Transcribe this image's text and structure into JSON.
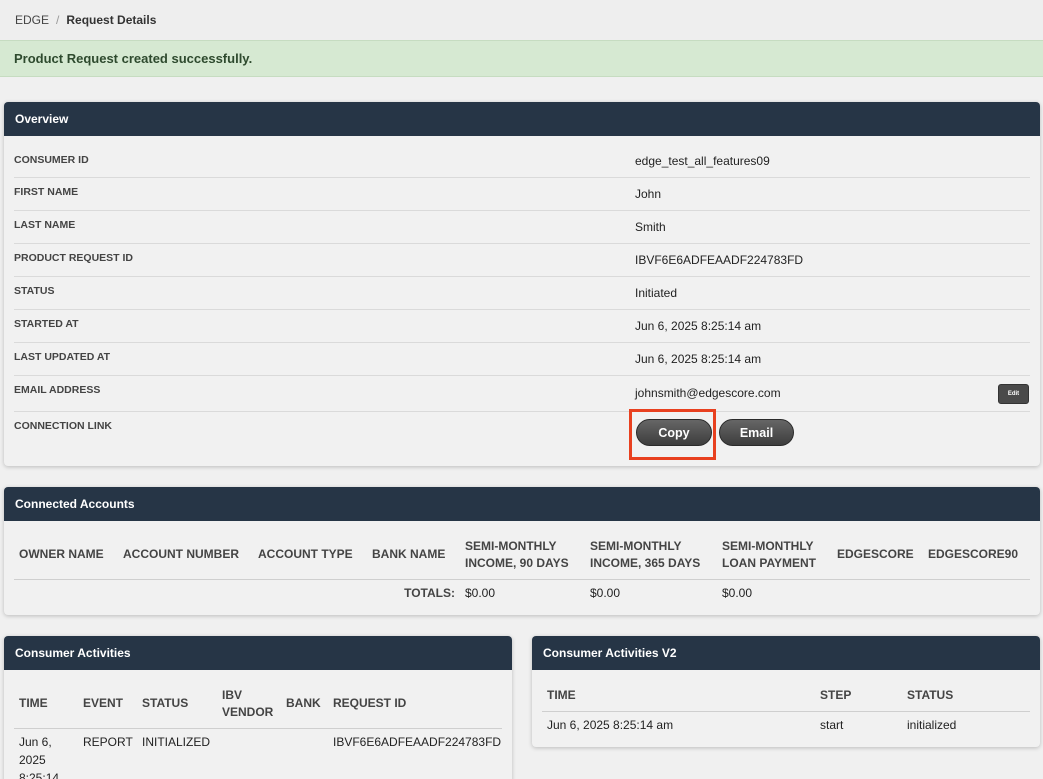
{
  "breadcrumb": {
    "root": "EDGE",
    "separator": "/",
    "current": "Request Details"
  },
  "alert": {
    "message": "Product Request created successfully."
  },
  "overview": {
    "title": "Overview",
    "rows": [
      {
        "label": "CONSUMER ID",
        "value": "edge_test_all_features09"
      },
      {
        "label": "FIRST NAME",
        "value": "John"
      },
      {
        "label": "LAST NAME",
        "value": "Smith"
      },
      {
        "label": "PRODUCT REQUEST ID",
        "value": "IBVF6E6ADFEAADF224783FD"
      },
      {
        "label": "STATUS",
        "value": "Initiated"
      },
      {
        "label": "STARTED AT",
        "value": "Jun 6, 2025 8:25:14 am"
      },
      {
        "label": "LAST UPDATED AT",
        "value": "Jun 6, 2025 8:25:14 am"
      },
      {
        "label": "EMAIL ADDRESS",
        "value": "johnsmith@edgescore.com"
      },
      {
        "label": "CONNECTION LINK",
        "value": ""
      }
    ],
    "edit_label": "Edit",
    "copy_label": "Copy",
    "email_label": "Email"
  },
  "connected_accounts": {
    "title": "Connected Accounts",
    "columns": [
      "OWNER NAME",
      "ACCOUNT NUMBER",
      "ACCOUNT TYPE",
      "BANK NAME",
      "SEMI-MONTHLY INCOME, 90 DAYS",
      "SEMI-MONTHLY INCOME, 365 DAYS",
      "SEMI-MONTHLY LOAN PAYMENT",
      "EDGESCORE",
      "EDGESCORE90"
    ],
    "totals_label": "TOTALS:",
    "totals": [
      "$0.00",
      "$0.00",
      "$0.00"
    ]
  },
  "consumer_activities": {
    "title": "Consumer Activities",
    "columns": [
      "TIME",
      "EVENT",
      "STATUS",
      "IBV VENDOR",
      "BANK",
      "REQUEST ID"
    ],
    "rows": [
      {
        "time": "Jun 6, 2025 8:25:14",
        "event": "REPORT",
        "status": "INITIALIZED",
        "ibv_vendor": "",
        "bank": "",
        "request_id": "IBVF6E6ADFEAADF224783FD"
      }
    ]
  },
  "consumer_activities_v2": {
    "title": "Consumer Activities V2",
    "columns": [
      "TIME",
      "STEP",
      "STATUS"
    ],
    "rows": [
      {
        "time": "Jun 6, 2025 8:25:14 am",
        "step": "start",
        "status": "initialized"
      }
    ]
  }
}
